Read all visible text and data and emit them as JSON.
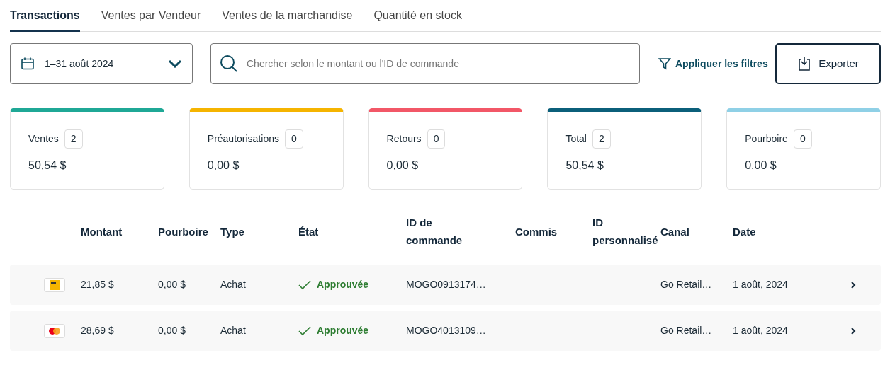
{
  "tabs": [
    {
      "label": "Transactions",
      "selected": true
    },
    {
      "label": "Ventes par Vendeur",
      "selected": false
    },
    {
      "label": "Ventes de la marchandise",
      "selected": false
    },
    {
      "label": "Quantité en stock",
      "selected": false
    }
  ],
  "date_range": {
    "value": "1–31 août 2024"
  },
  "search": {
    "placeholder": "Chercher selon le montant ou l'ID de commande"
  },
  "filter_link": "Appliquer les filtres",
  "export_button": "Exporter",
  "stats": [
    {
      "label": "Ventes",
      "count": "2",
      "amount": "50,54 $",
      "color": "#1fa896"
    },
    {
      "label": "Préautorisations",
      "count": "0",
      "amount": "0,00 $",
      "color": "#f5b400"
    },
    {
      "label": "Retours",
      "count": "0",
      "amount": "0,00 $",
      "color": "#f25767"
    },
    {
      "label": "Total",
      "count": "2",
      "amount": "50,54 $",
      "color": "#0b5f7a"
    },
    {
      "label": "Pourboire",
      "count": "0",
      "amount": "0,00 $",
      "color": "#8fd0e6"
    }
  ],
  "table": {
    "columns": [
      "Montant",
      "Pourboire",
      "Type",
      "État",
      "ID de\ncommande",
      "Commis",
      "ID\npersonnalisé",
      "Canal",
      "Date"
    ],
    "rows": [
      {
        "kind": "yellow",
        "amount": "21,85 $",
        "tip": "0,00 $",
        "type": "Achat",
        "status": {
          "label": "Approuvée",
          "kind": "approved"
        },
        "order_id": "MOGO0913174…",
        "channel": "Go Retail…",
        "date": "1 août, 2024"
      },
      {
        "kind": "circles",
        "amount": "28,69 $",
        "tip": "0,00 $",
        "type": "Achat",
        "status": {
          "label": "Approuvée",
          "kind": "approved"
        },
        "order_id": "MOGO4013109…",
        "channel": "Go Retail…",
        "date": "1 août, 2024"
      }
    ]
  }
}
